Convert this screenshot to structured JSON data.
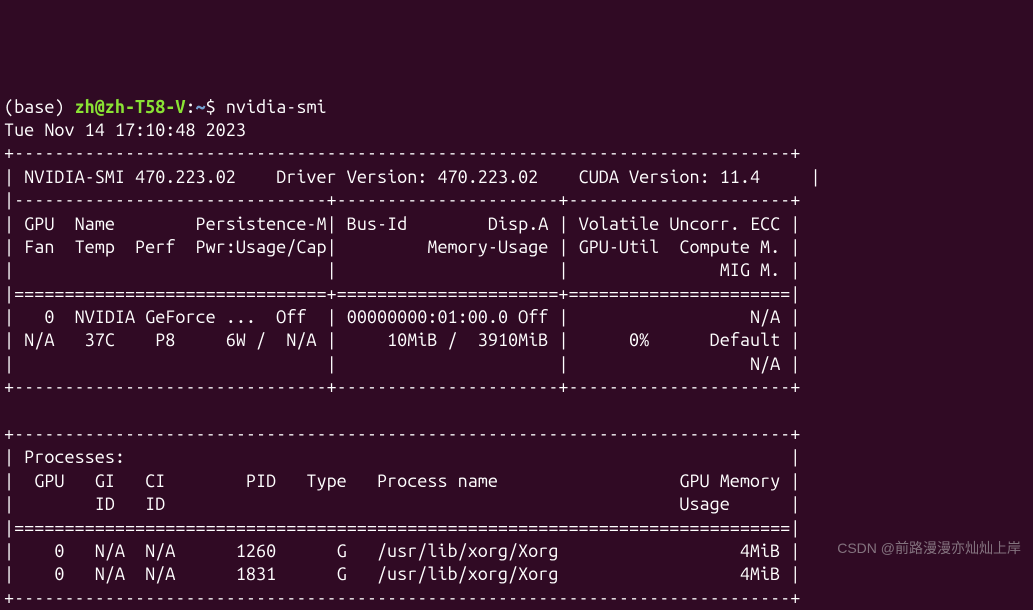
{
  "prompt": {
    "env": "(base) ",
    "user_host": "zh@zh-T58-V",
    "colon": ":",
    "path": "~",
    "symbol": "$ ",
    "command": "nvidia-smi"
  },
  "timestamp": "Tue Nov 14 17:10:48 2023",
  "header": {
    "smi_version": "NVIDIA-SMI 470.223.02",
    "driver_version": "Driver Version: 470.223.02",
    "cuda_version": "CUDA Version: 11.4"
  },
  "col_headers": {
    "r1c1": " GPU  Name        Persistence-M",
    "r1c2": " Bus-Id        Disp.A ",
    "r1c3": " Volatile Uncorr. ECC ",
    "r2c1": " Fan  Temp  Perf  Pwr:Usage/Cap",
    "r2c2": "         Memory-Usage ",
    "r2c3": " GPU-Util  Compute M. ",
    "r3c1": "                               ",
    "r3c2": "                      ",
    "r3c3": "               MIG M. "
  },
  "gpu": {
    "r1c1": "   0  NVIDIA GeForce ...  Off  ",
    "r1c2": " 00000000:01:00.0 Off ",
    "r1c3": "                  N/A ",
    "r2c1": " N/A   37C    P8     6W /  N/A ",
    "r2c2": "     10MiB /  3910MiB ",
    "r2c3": "      0%      Default ",
    "r3c1": "                               ",
    "r3c2": "                      ",
    "r3c3": "                  N/A "
  },
  "processes": {
    "title": " Processes:",
    "h1": "  GPU   GI   CI        PID   Type   Process name                  GPU Memory ",
    "h2": "        ID   ID                                                   Usage      ",
    "p1": "    0   N/A  N/A      1260      G   /usr/lib/xorg/Xorg                  4MiB ",
    "p2": "    0   N/A  N/A      1831      G   /usr/lib/xorg/Xorg                  4MiB "
  },
  "border": {
    "top": "+-----------------------------------------------------------------------------+",
    "mid3": "|-------------------------------+----------------------+----------------------+",
    "eq3": "|===============================+======================+======================|",
    "bot3": "+-------------------------------+----------------------+----------------------+",
    "eq1": "|=============================================================================|",
    "bot": "+-----------------------------------------------------------------------------+",
    "blank": "                                                                               "
  },
  "watermark": "CSDN @前路漫漫亦灿灿上岸"
}
